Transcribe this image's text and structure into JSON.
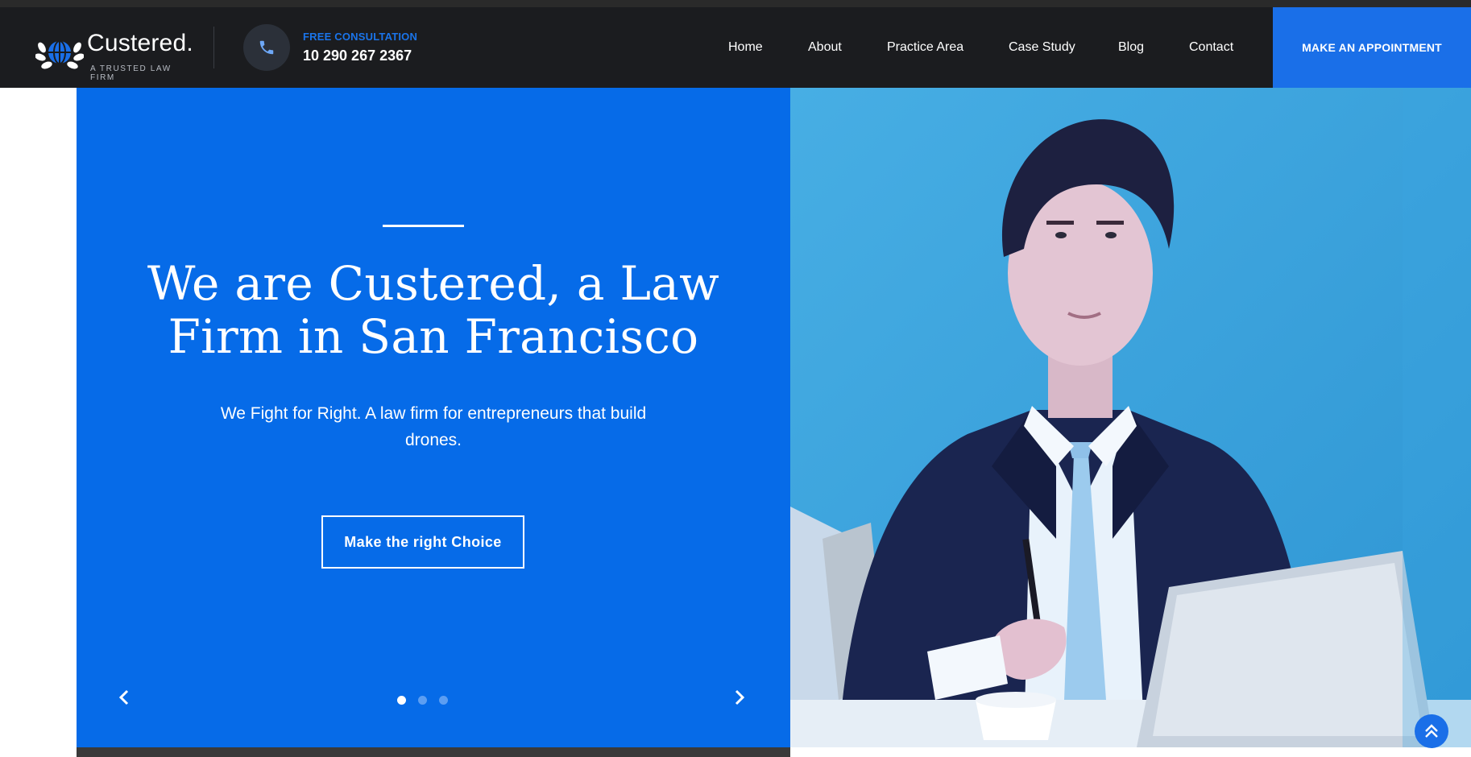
{
  "brand": {
    "name": "Custered.",
    "tagline": "A TRUSTED LAW FIRM"
  },
  "contact": {
    "label": "FREE CONSULTATION",
    "phone": "10 290 267 2367",
    "icon": "phone-icon"
  },
  "nav": {
    "items": [
      "Home",
      "About",
      "Practice Area",
      "Case Study",
      "Blog",
      "Contact"
    ],
    "cta": "MAKE AN APPOINTMENT"
  },
  "hero": {
    "title": "We are Custered, a Law Firm in San Francisco",
    "subtitle": "We Fight for Right. A law firm for entrepreneurs that build drones.",
    "button": "Make the right Choice",
    "slides_total": 3,
    "active_slide": 1,
    "prev_icon": "chevron-left-icon",
    "next_icon": "chevron-right-icon"
  },
  "colors": {
    "header_bg": "#1b1c1f",
    "accent": "#1a6fe8",
    "hero_bg": "#066be8",
    "image_bg": "#3da7e0"
  },
  "scroll_top_icon": "double-chevron-up-icon"
}
